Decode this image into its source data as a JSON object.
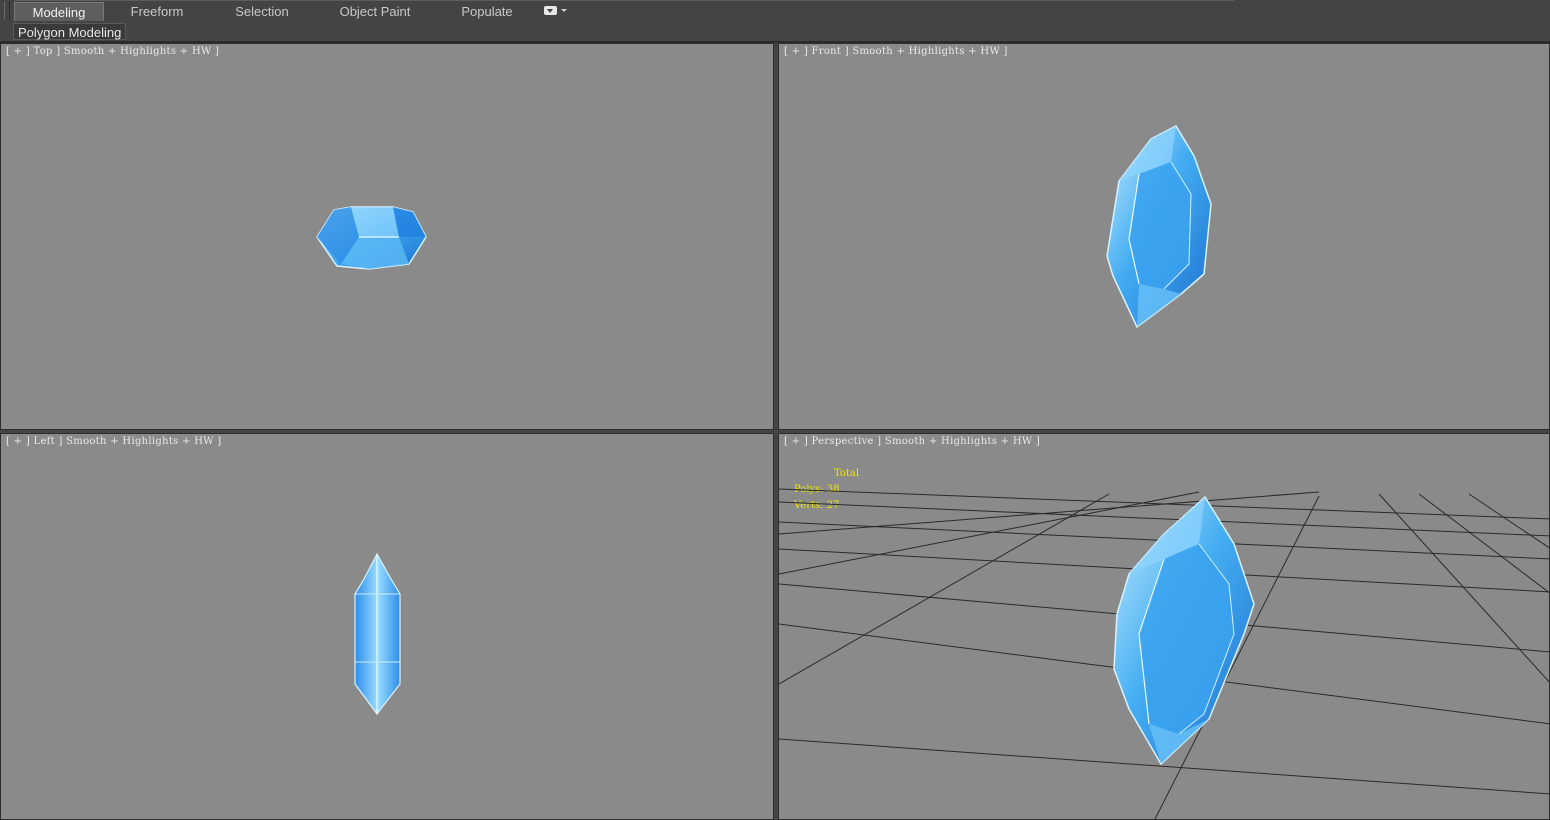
{
  "ribbon": {
    "tabs": [
      {
        "label": "Modeling",
        "active": true
      },
      {
        "label": "Freeform",
        "active": false
      },
      {
        "label": "Selection",
        "active": false
      },
      {
        "label": "Object Paint",
        "active": false
      },
      {
        "label": "Populate",
        "active": false
      }
    ],
    "menu_icon": "ribbon-options-icon",
    "panel_label": "Polygon Modeling"
  },
  "viewports": {
    "top": {
      "label": "[ + ] Top ] Smooth + Highlights + HW ]"
    },
    "front": {
      "label": "[ + ] Front ] Smooth + Highlights + HW ]"
    },
    "left": {
      "label": "[ + ] Left ] Smooth + Highlights + HW ]"
    },
    "perspective": {
      "label": "[ + ] Perspective ] Smooth + Highlights + HW ]"
    }
  },
  "stats": {
    "header": "Total",
    "polys": "Polys: 38",
    "verts": "Verts: 27"
  },
  "colors": {
    "viewport_bg": "#8a8a8a",
    "ui_bg": "#444444",
    "stats_text": "#f2e600",
    "crystal_light": "#bfeaff",
    "crystal_mid": "#3fa8f0",
    "crystal_dark": "#1a6fd0"
  }
}
